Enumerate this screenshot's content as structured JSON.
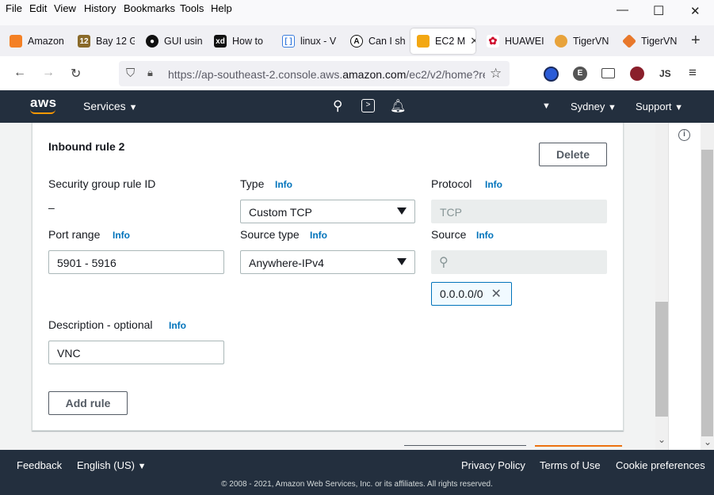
{
  "menubar": {
    "items": [
      "File",
      "Edit",
      "View",
      "History",
      "Bookmarks",
      "Tools",
      "Help"
    ],
    "window_controls": [
      "—",
      "☐",
      "✕"
    ]
  },
  "tabs": [
    {
      "label": "Amazon",
      "icon": "amazon-icon",
      "color": "#f48024"
    },
    {
      "label": "Bay 12 G",
      "icon": "bay12-icon",
      "color": "#8a6a2a"
    },
    {
      "label": "GUI usin",
      "icon": "github-icon",
      "color": "#111"
    },
    {
      "label": "How to",
      "icon": "xda-icon",
      "color": "#111"
    },
    {
      "label": "linux - V",
      "icon": "brackets-icon",
      "color": "#3b7ddd"
    },
    {
      "label": "Can I sh",
      "icon": "askubuntu-icon",
      "color": "#111"
    },
    {
      "label": "EC2 M",
      "icon": "ec2-icon",
      "color": "#f3a712"
    },
    {
      "label": "HUAWEI",
      "icon": "huawei-icon",
      "color": "#cf0a2c"
    },
    {
      "label": "TigerVN",
      "icon": "tigervnc-icon",
      "color": "#e8a33b"
    },
    {
      "label": "TigerVN",
      "icon": "tigervnc-diamond-icon",
      "color": "#e8782b"
    }
  ],
  "navbar": {
    "url_prefix": "https://ap-southeast-2.console.aws.",
    "url_domain": "amazon.com",
    "url_suffix": "/ec2/v2/home?re",
    "account_initials": "JS",
    "ext_letter": "E"
  },
  "aws_header": {
    "logo": "aws",
    "services": "Services",
    "region": "Sydney",
    "support": "Support"
  },
  "rule": {
    "title": "Inbound rule 2",
    "delete_label": "Delete",
    "sg_rule_id_label": "Security group rule ID",
    "sg_rule_id_value": "–",
    "type_label": "Type",
    "type_value": "Custom TCP",
    "protocol_label": "Protocol",
    "protocol_value": "TCP",
    "port_range_label": "Port range",
    "port_range_value": "5901 - 5916",
    "source_type_label": "Source type",
    "source_type_value": "Anywhere-IPv4",
    "source_label": "Source",
    "source_token": "0.0.0.0/0",
    "description_label": "Description - optional",
    "description_value": "VNC",
    "info": "Info",
    "add_rule_label": "Add rule"
  },
  "footer": {
    "feedback": "Feedback",
    "language": "English (US)",
    "privacy": "Privacy Policy",
    "terms": "Terms of Use",
    "cookies": "Cookie preferences",
    "copyright": "© 2008 - 2021, Amazon Web Services, Inc. or its affiliates. All rights reserved."
  }
}
